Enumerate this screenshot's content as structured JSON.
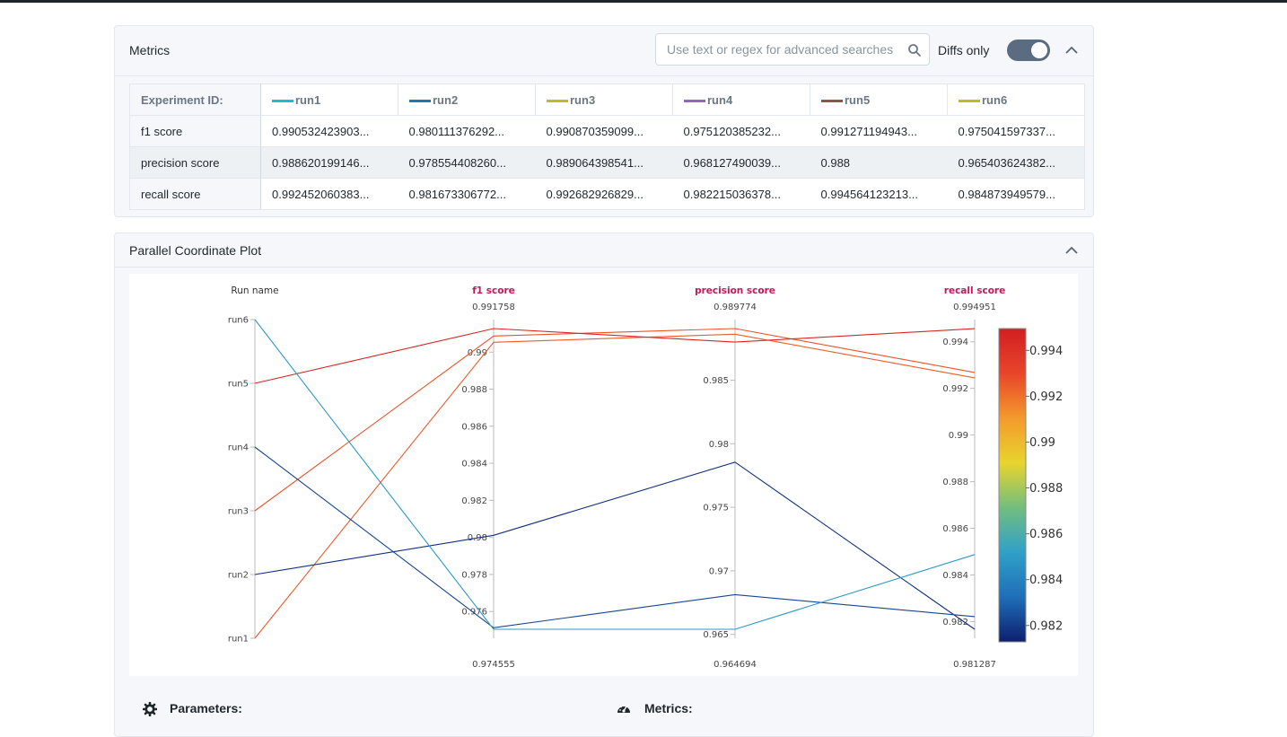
{
  "metrics": {
    "title": "Metrics",
    "search_placeholder": "Use text or regex for advanced searches",
    "diffs_label": "Diffs only",
    "diffs_on": true,
    "table": {
      "id_header": "Experiment ID:",
      "runs": [
        {
          "name": "run1",
          "color": "#17becf"
        },
        {
          "name": "run2",
          "color": "#1f77b4"
        },
        {
          "name": "run3",
          "color": "#bcbd22"
        },
        {
          "name": "run4",
          "color": "#9467bd"
        },
        {
          "name": "run5",
          "color": "#8c564b"
        },
        {
          "name": "run6",
          "color": "#bcbd22"
        }
      ],
      "rows": [
        {
          "label": "f1 score",
          "values": [
            "0.990532423903...",
            "0.980111376292...",
            "0.990870359099...",
            "0.975120385232...",
            "0.991271194943...",
            "0.975041597337..."
          ]
        },
        {
          "label": "precision score",
          "values": [
            "0.988620199146...",
            "0.978554408260...",
            "0.989064398541...",
            "0.968127490039...",
            "0.988",
            "0.965403624382..."
          ]
        },
        {
          "label": "recall score",
          "values": [
            "0.992452060383...",
            "0.981673306772...",
            "0.992682926829...",
            "0.982215036378...",
            "0.994564123213...",
            "0.984873949579..."
          ]
        }
      ]
    }
  },
  "pcp": {
    "title": "Parallel Coordinate Plot"
  },
  "footer": {
    "parameters_label": "Parameters:",
    "metrics_label": "Metrics:"
  },
  "chart_data": {
    "type": "parallel_coordinates",
    "axes": [
      {
        "label": "Run name",
        "categorical": true,
        "ticks": [
          "run1",
          "run2",
          "run3",
          "run4",
          "run5",
          "run6"
        ]
      },
      {
        "label": "f1 score",
        "range": [
          0.974555,
          0.991758
        ],
        "ticks": [
          0.976,
          0.978,
          0.98,
          0.982,
          0.984,
          0.986,
          0.988,
          0.99
        ],
        "tick_labels": [
          "0.976",
          "0.978",
          "0.98",
          "0.982",
          "0.984",
          "0.986",
          "0.988",
          "0.99"
        ],
        "min_label": "0.974555",
        "max_label": "0.991758"
      },
      {
        "label": "precision score",
        "range": [
          0.964694,
          0.989774
        ],
        "ticks": [
          0.965,
          0.97,
          0.975,
          0.98,
          0.985
        ],
        "tick_labels": [
          "0.965",
          "0.97",
          "0.975",
          "0.98",
          "0.985"
        ],
        "min_label": "0.964694",
        "max_label": "0.989774"
      },
      {
        "label": "recall score",
        "range": [
          0.981287,
          0.994951
        ],
        "ticks": [
          0.982,
          0.984,
          0.986,
          0.988,
          0.99,
          0.992,
          0.994
        ],
        "tick_labels": [
          "0.982",
          "0.984",
          "0.986",
          "0.988",
          "0.99",
          "0.992",
          "0.994"
        ],
        "min_label": "0.981287",
        "max_label": "0.994951"
      }
    ],
    "colorbar": {
      "range": [
        0.981287,
        0.994951
      ],
      "ticks": [
        0.982,
        0.984,
        0.986,
        0.988,
        0.99,
        0.992,
        0.994
      ],
      "tick_labels": [
        "0.982",
        "0.984",
        "0.986",
        "0.988",
        "0.99",
        "0.992",
        "0.994"
      ],
      "colorscale": [
        "#0d1f6e",
        "#1f6eb8",
        "#30a0c8",
        "#72be7e",
        "#e8d42e",
        "#f39a2c",
        "#e8452a",
        "#d21f22"
      ]
    },
    "lines": [
      {
        "run": "run1",
        "f1": 0.990532,
        "precision": 0.98862,
        "recall": 0.992452
      },
      {
        "run": "run2",
        "f1": 0.980111,
        "precision": 0.978554,
        "recall": 0.981673
      },
      {
        "run": "run3",
        "f1": 0.99087,
        "precision": 0.989064,
        "recall": 0.992683
      },
      {
        "run": "run4",
        "f1": 0.97512,
        "precision": 0.968127,
        "recall": 0.982215
      },
      {
        "run": "run5",
        "f1": 0.991271,
        "precision": 0.988,
        "recall": 0.994564
      },
      {
        "run": "run6",
        "f1": 0.975042,
        "precision": 0.965404,
        "recall": 0.984874
      }
    ]
  }
}
